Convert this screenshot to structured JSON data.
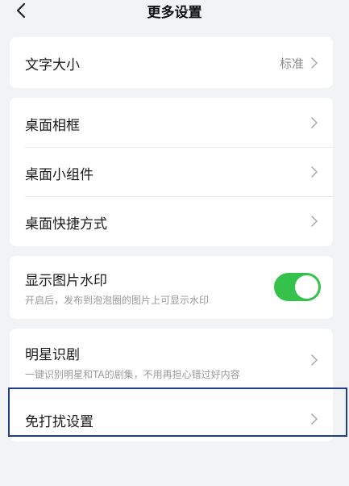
{
  "header": {
    "title": "更多设置"
  },
  "settings": {
    "font_size": {
      "label": "文字大小",
      "value": "标准"
    },
    "desktop": {
      "frame": "桌面相框",
      "widget": "桌面小组件",
      "shortcut": "桌面快捷方式"
    },
    "watermark": {
      "label": "显示图片水印",
      "desc": "开启后，发布到泡泡圈的图片上可显示水印",
      "enabled": true
    },
    "star": {
      "label": "明星识剧",
      "desc": "一键识别明星和TA的剧集，不用再担心错过好内容"
    },
    "dnd": {
      "label": "免打扰设置"
    }
  },
  "colors": {
    "toggle_on": "#35c24a",
    "highlight": "#1f3d8a"
  }
}
